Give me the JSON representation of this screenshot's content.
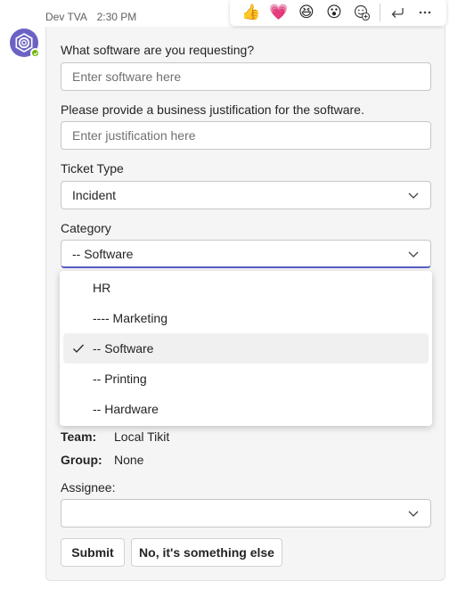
{
  "message": {
    "sender": "Dev TVA",
    "time": "2:30 PM"
  },
  "reactions": {
    "items": [
      {
        "name": "like",
        "glyph": "👍"
      },
      {
        "name": "heart",
        "glyph": "💗"
      },
      {
        "name": "laugh",
        "glyph": "😆"
      },
      {
        "name": "surprised",
        "glyph": "😮"
      }
    ]
  },
  "form": {
    "software": {
      "label": "What software are you requesting?",
      "placeholder": "Enter software here"
    },
    "justification": {
      "label": "Please provide a business justification for the software.",
      "placeholder": "Enter justification here"
    },
    "ticket_type": {
      "label": "Ticket Type",
      "value": "Incident"
    },
    "category": {
      "label": "Category",
      "value": "-- Software",
      "options": [
        "HR",
        "---- Marketing",
        "-- Software",
        "-- Printing",
        "-- Hardware"
      ],
      "selected_option": "-- Software"
    },
    "team": {
      "key": "Team:",
      "value": "Local Tikit"
    },
    "group": {
      "key": "Group:",
      "value": "None"
    },
    "assignee": {
      "label": "Assignee:",
      "value": ""
    },
    "submit_label": "Submit",
    "else_label": "No, it's something else"
  },
  "colors": {
    "accent": "#5b5fc7",
    "avatar": "#6b63c4",
    "presence": "#6bb700"
  }
}
